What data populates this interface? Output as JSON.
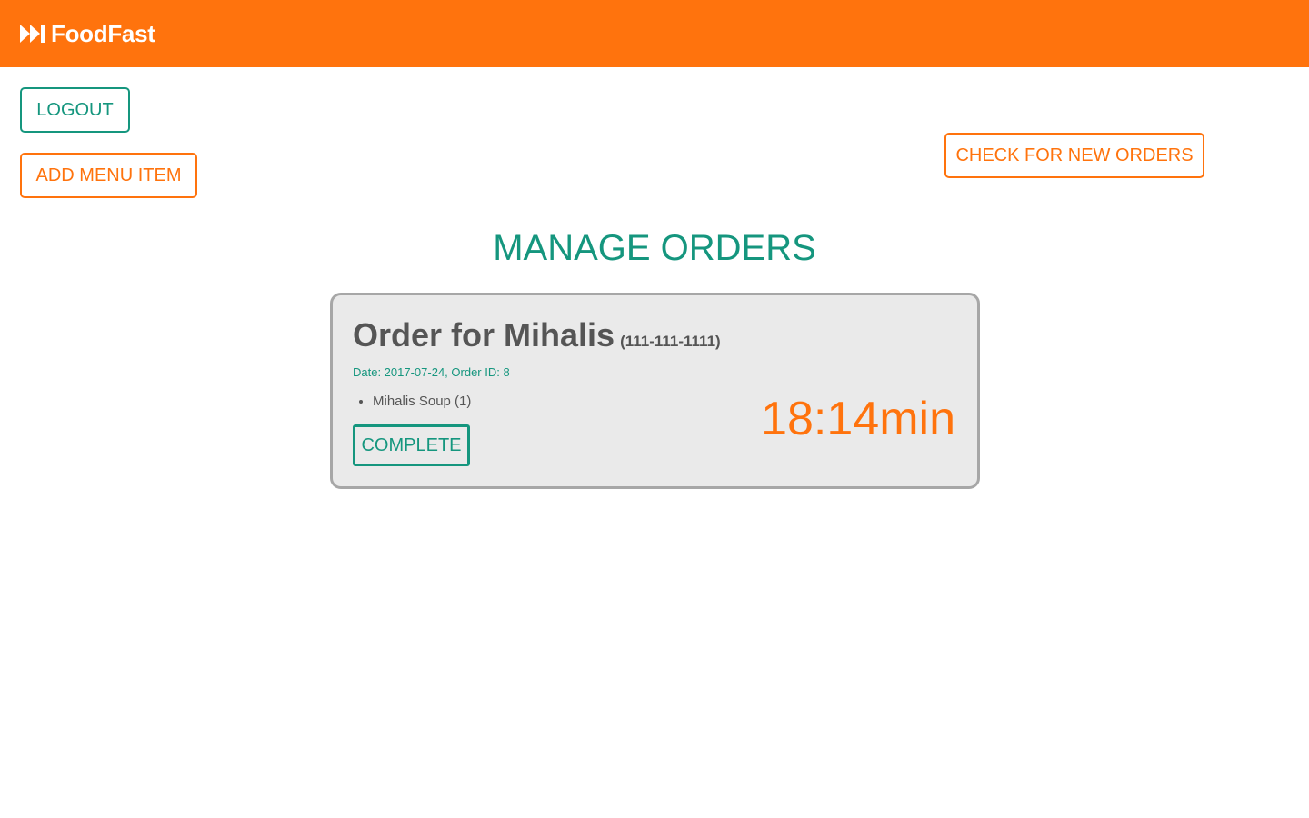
{
  "header": {
    "brand": "FoodFast",
    "brand_icon": "fast-forward-icon",
    "background_color": "#ff730d"
  },
  "actions": {
    "logout_label": "LOGOUT",
    "add_menu_item_label": "ADD MENU ITEM",
    "check_new_orders_label": "CHECK FOR NEW ORDERS"
  },
  "main": {
    "title": "MANAGE ORDERS"
  },
  "orders": [
    {
      "heading": "Order for Mihalis",
      "phone": "(111-111-1111)",
      "meta": "Date: 2017-07-24, Order ID: 8",
      "items": [
        "Mihalis Soup (1)"
      ],
      "complete_label": "COMPLETE",
      "timer": "18:14min"
    }
  ],
  "colors": {
    "accent_orange": "#ff730d",
    "accent_green": "#15967e",
    "card_background": "#eaeaea",
    "card_border": "#a7a7a7",
    "text_gray": "#555555"
  }
}
